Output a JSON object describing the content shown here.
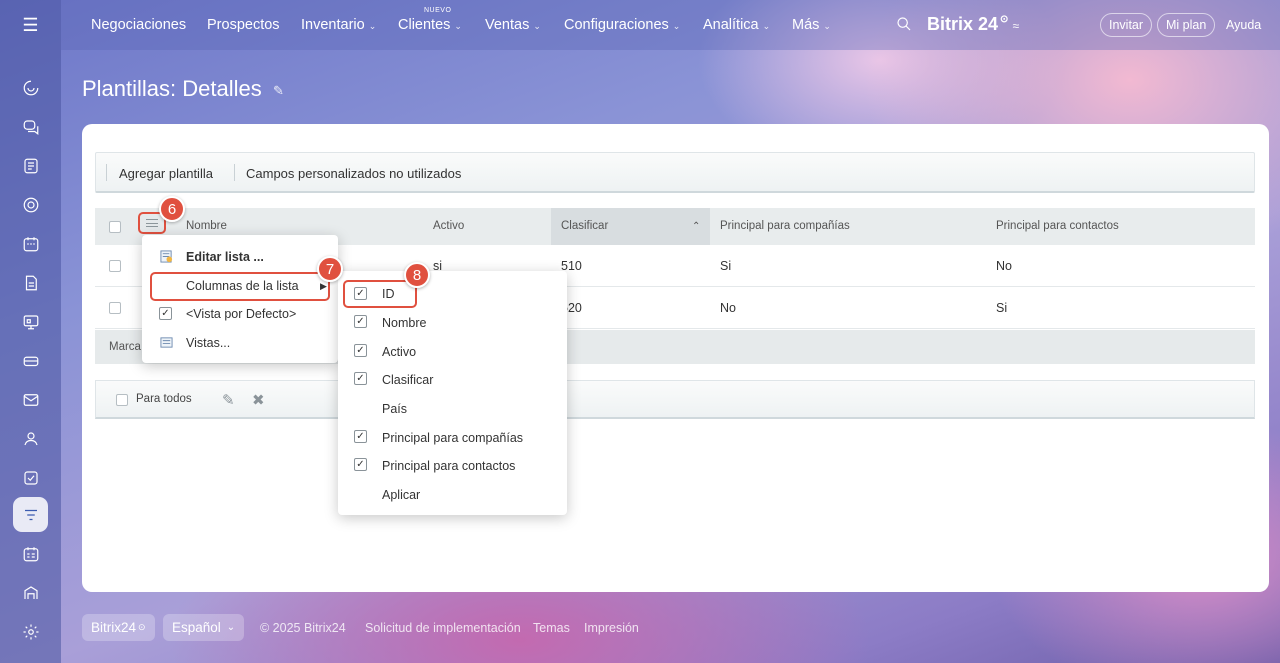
{
  "nav": {
    "items": [
      {
        "label": "Negociaciones"
      },
      {
        "label": "Prospectos"
      },
      {
        "label": "Inventario",
        "chevron": "⌄"
      },
      {
        "label": "Clientes",
        "chevron": "⌄"
      },
      {
        "label": "Ventas",
        "chevron": "⌄"
      },
      {
        "label": "Configuraciones",
        "chevron": "⌄"
      },
      {
        "label": "Analítica",
        "chevron": "⌄"
      },
      {
        "label": "Más",
        "chevron": "⌄"
      }
    ],
    "new_badge": "NUEVO",
    "brand": "Bitrix 24",
    "invite": "Invitar",
    "my_plan": "Mi plan",
    "help": "Ayuda"
  },
  "sidebar": {
    "icons": [
      "menu-icon",
      "copilot-icon",
      "chat-icon",
      "feed-icon",
      "target-icon",
      "calendar-icon",
      "document-icon",
      "board-icon",
      "drive-icon",
      "mail-icon",
      "contacts-icon",
      "tasks-icon",
      "crm-funnel-icon",
      "schedule-icon",
      "store-icon",
      "settings-icon"
    ]
  },
  "page": {
    "title": "Plantillas: Detalles"
  },
  "toolbar": {
    "add_template": "Agregar plantilla",
    "unused_fields": "Campos personalizados no utilizados"
  },
  "grid": {
    "columns": [
      "Nombre",
      "Activo",
      "Clasificar",
      "Principal para compañías",
      "Principal para contactos"
    ],
    "sorted_column": "Clasificar",
    "rows": [
      {
        "activo": "si",
        "clasificar": "510",
        "companias": "Si",
        "contactos": "No"
      },
      {
        "activo": "",
        "clasificar": "520",
        "companias": "No",
        "contactos": "Si"
      }
    ],
    "footer_text": "Marca",
    "for_all": "Para todos"
  },
  "context_menu": {
    "items": [
      {
        "label": "Editar lista ..."
      },
      {
        "label": "Columnas de la lista"
      },
      {
        "label": "<Vista por Defecto>"
      },
      {
        "label": "Vistas..."
      }
    ]
  },
  "columns_menu": {
    "items": [
      {
        "label": "ID",
        "checked": true
      },
      {
        "label": "Nombre",
        "checked": true
      },
      {
        "label": "Activo",
        "checked": true
      },
      {
        "label": "Clasificar",
        "checked": true
      },
      {
        "label": "País",
        "checked": false
      },
      {
        "label": "Principal para compañías",
        "checked": true
      },
      {
        "label": "Principal para contactos",
        "checked": true
      },
      {
        "label": "Aplicar",
        "checked": false
      }
    ]
  },
  "steps": {
    "s6": "6",
    "s7": "7",
    "s8": "8"
  },
  "footer": {
    "brand": "Bitrix24",
    "language": "Español",
    "copyright": "© 2025 Bitrix24",
    "implementation": "Solicitud de implementación",
    "themes": "Temas",
    "print": "Impresión"
  },
  "colors": {
    "accent": "#e0503f",
    "active_sidebar": "#3b5bb0"
  }
}
